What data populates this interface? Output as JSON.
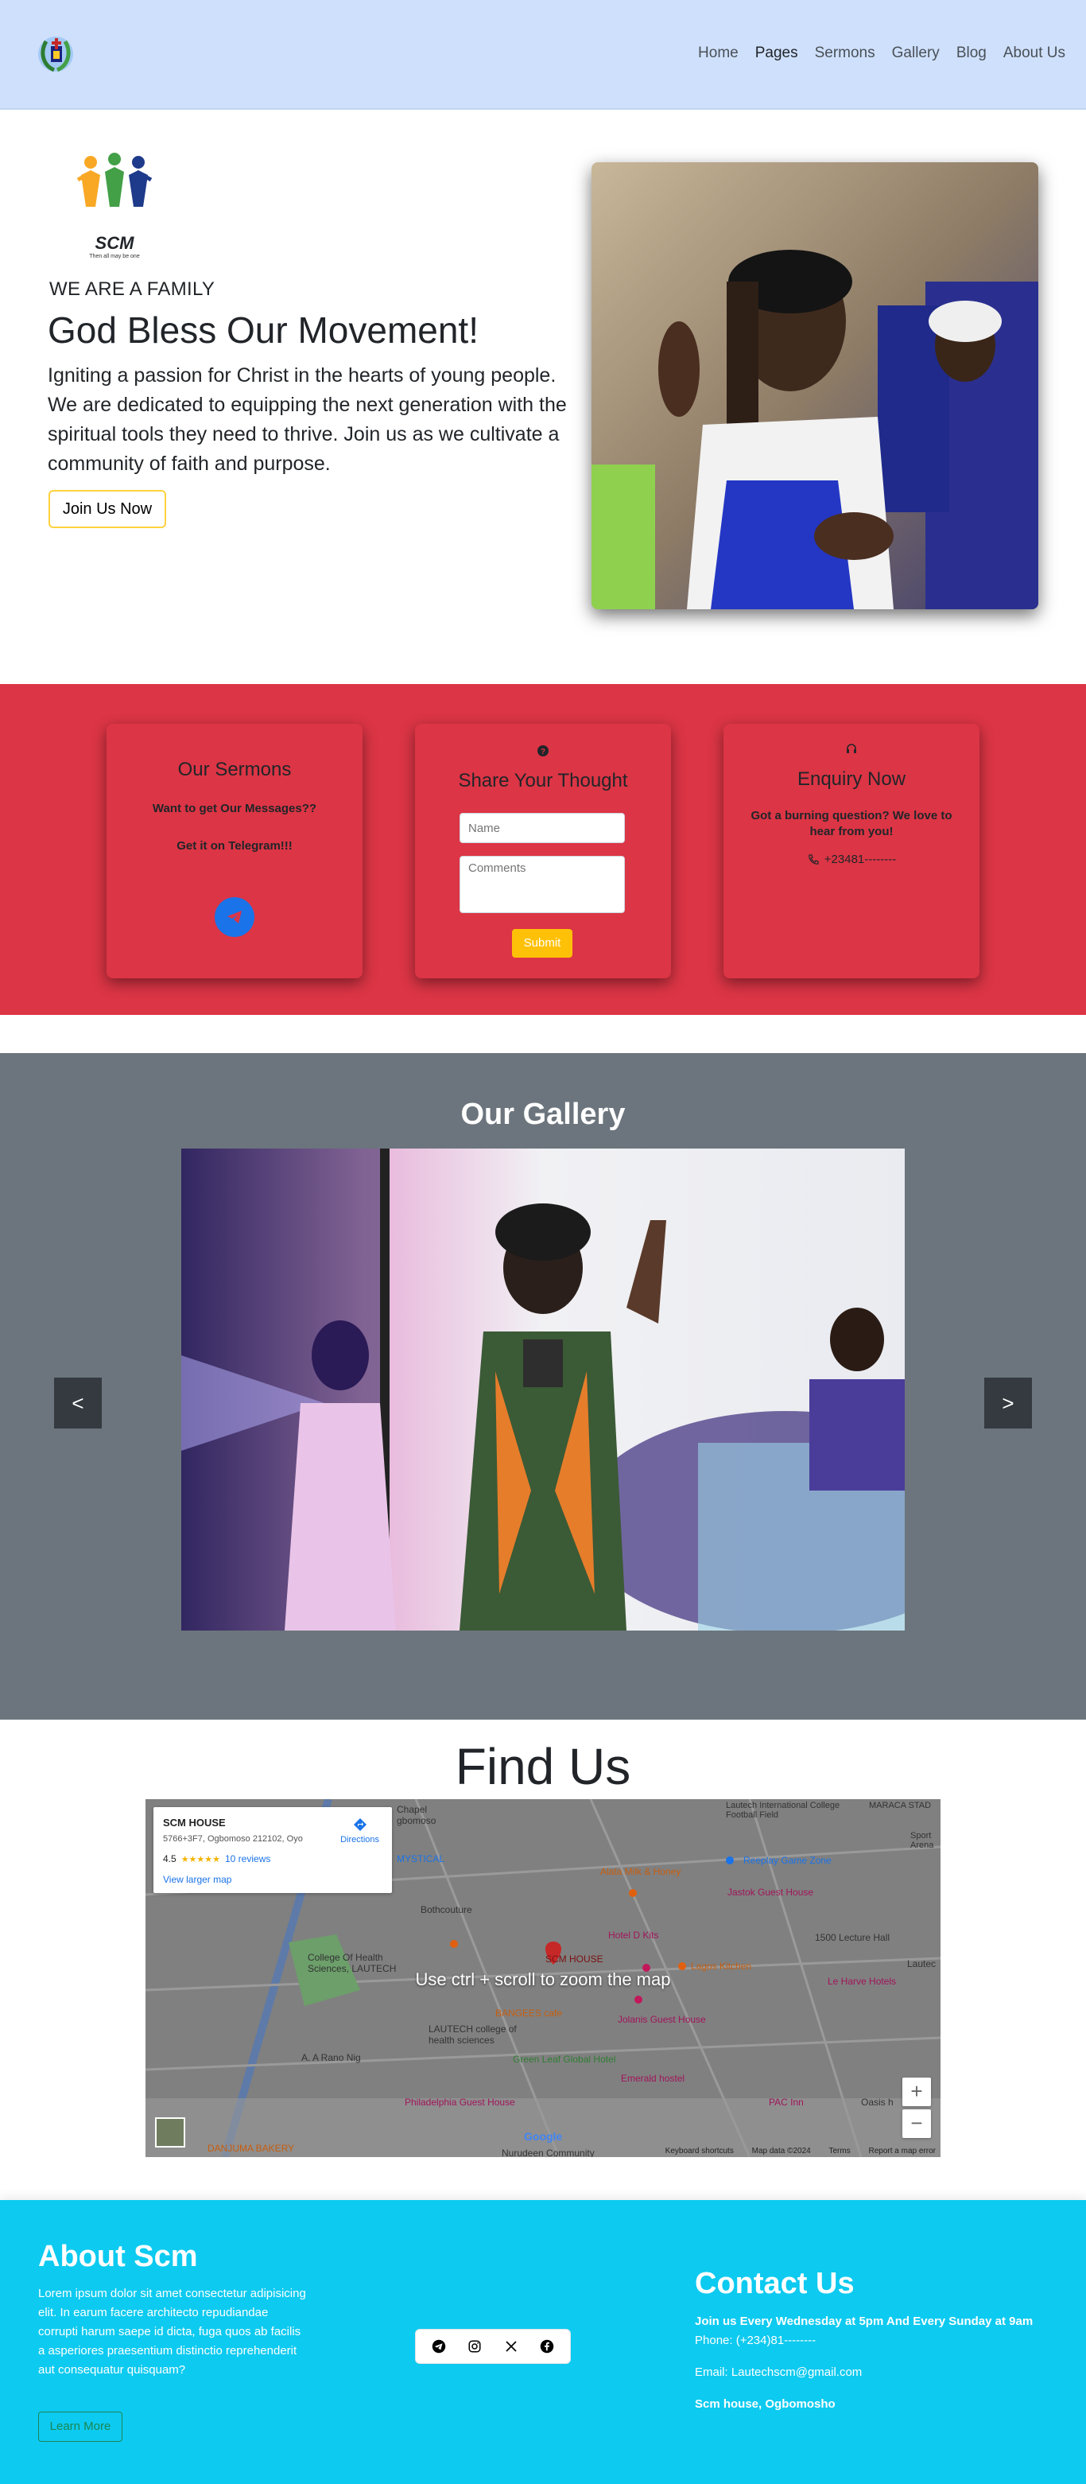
{
  "navbar": {
    "logo_icon": "church-logo-icon",
    "links": [
      {
        "label": "Home"
      },
      {
        "label": "Pages"
      },
      {
        "label": "Sermons"
      },
      {
        "label": "Gallery"
      },
      {
        "label": "Blog"
      },
      {
        "label": "About Us"
      }
    ]
  },
  "hero": {
    "logo_text": "SCM",
    "logo_motto": "Then all may be one",
    "tagline": "WE ARE A FAMILY",
    "title": "God Bless Our Movement!",
    "text": "Igniting a passion for Christ in the hearts of young people. We are dedicated to equipping the next generation with the spiritual tools they need to thrive. Join us as we cultivate a community of faith and purpose.",
    "join_button": "Join Us Now",
    "photo_icon": "worshipper-photo"
  },
  "cards": {
    "sermons": {
      "title": "Our Sermons",
      "line1": "Want to get Our Messages??",
      "line2": "Get it on Telegram!!!",
      "icon": "telegram-icon"
    },
    "thought": {
      "title": "Share Your Thought",
      "icon": "question-circle-icon",
      "name_placeholder": "Name",
      "comments_placeholder": "Comments",
      "submit_label": "Submit"
    },
    "enquiry": {
      "title": "Enquiry Now",
      "icon": "headset-icon",
      "text": "Got a burning question? We love to hear from you!",
      "phone": "+23481--------"
    }
  },
  "gallery": {
    "title": "Our Gallery",
    "prev_label": "<",
    "next_label": ">",
    "photo_icon": "gallery-photo"
  },
  "findus": {
    "title": "Find Us",
    "map": {
      "place_name": "SCM HOUSE",
      "address": "5766+3F7, Ogbomoso 212102, Oyo",
      "rating": "4.5",
      "reviews": "10 reviews",
      "directions": "Directions",
      "larger_map": "View larger map",
      "zoom_hint": "Use ctrl + scroll to zoom the map",
      "zoom_in": "+",
      "zoom_out": "−",
      "google": "Google",
      "shortcuts": "Keyboard shortcuts",
      "map_data": "Map data ©2024",
      "terms": "Terms",
      "report": "Report a map error",
      "labels": [
        "SCM HOUSE",
        "Alata Milk & Honey",
        "Reeplay Game Zone",
        "Jastok Guest House",
        "Hotel D Kits",
        "Lagos Kitchen",
        "1500 Lecture Hall",
        "Le Harve Hotels",
        "BANGEES cafe",
        "Jolanis Guest House",
        "Green Leaf Global Hotel",
        "Emerald hostel",
        "LAUTECH college of health sciences",
        "College Of Health Sciences, LAUTECH",
        "Bothcouture",
        "MYSTICAL",
        "A. A Rano Nig",
        "Philadelphia Guest House",
        "PAC Inn",
        "Oasis h",
        "DANJUMA BAKERY",
        "Nurudeen Community",
        "MARACA STAD",
        "Lautech International College Football Field",
        "Chapel gbomoso",
        "Lautec",
        "Sport Arena"
      ]
    }
  },
  "footer": {
    "about_title": "About Scm",
    "about_text": "Lorem ipsum dolor sit amet consectetur adipisicing elit. In earum facere architecto repudiandae corrupti harum saepe id dicta, fuga quos ab facilis a asperiores praesentium distinctio reprehenderit aut consequatur quisquam?",
    "learn_more": "Learn More",
    "socials": [
      "telegram-icon",
      "instagram-icon",
      "x-icon",
      "facebook-icon"
    ],
    "contact_title": "Contact Us",
    "meeting": "Join us Every Wednesday at 5pm And Every Sunday at 9am",
    "phone": "Phone: (+234)81--------",
    "email": "Email: Lautechscm@gmail.com",
    "address": "Scm house, Ogbomosho"
  },
  "colors": {
    "navbar": "#cfe0fc",
    "red_band": "#dc3545",
    "gallery_bg": "#6c757d",
    "footer": "#0dcaf0",
    "accent_yellow": "#ffc107"
  }
}
